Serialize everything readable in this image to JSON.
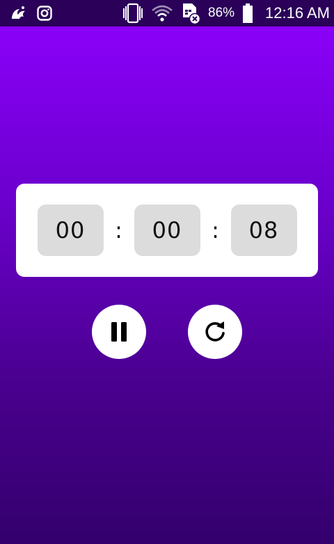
{
  "status_bar": {
    "battery_percent": "86%",
    "time": "12:16 AM",
    "left_icons": [
      "uc-browser-icon",
      "instagram-icon"
    ],
    "right_icons": [
      "vibrate-icon",
      "wifi-icon",
      "no-sim-icon",
      "battery-icon"
    ]
  },
  "timer": {
    "hours": "00",
    "separator_1": ":",
    "minutes": "00",
    "separator_2": ":",
    "seconds": "08"
  },
  "controls": {
    "pause_icon": "pause-icon",
    "reset_icon": "refresh-icon"
  },
  "colors": {
    "background_top": "#8f00ff",
    "background_bottom": "#33006d",
    "status_bar": "#2a0059",
    "card": "#ffffff",
    "digit_box": "#dcdcdc"
  }
}
